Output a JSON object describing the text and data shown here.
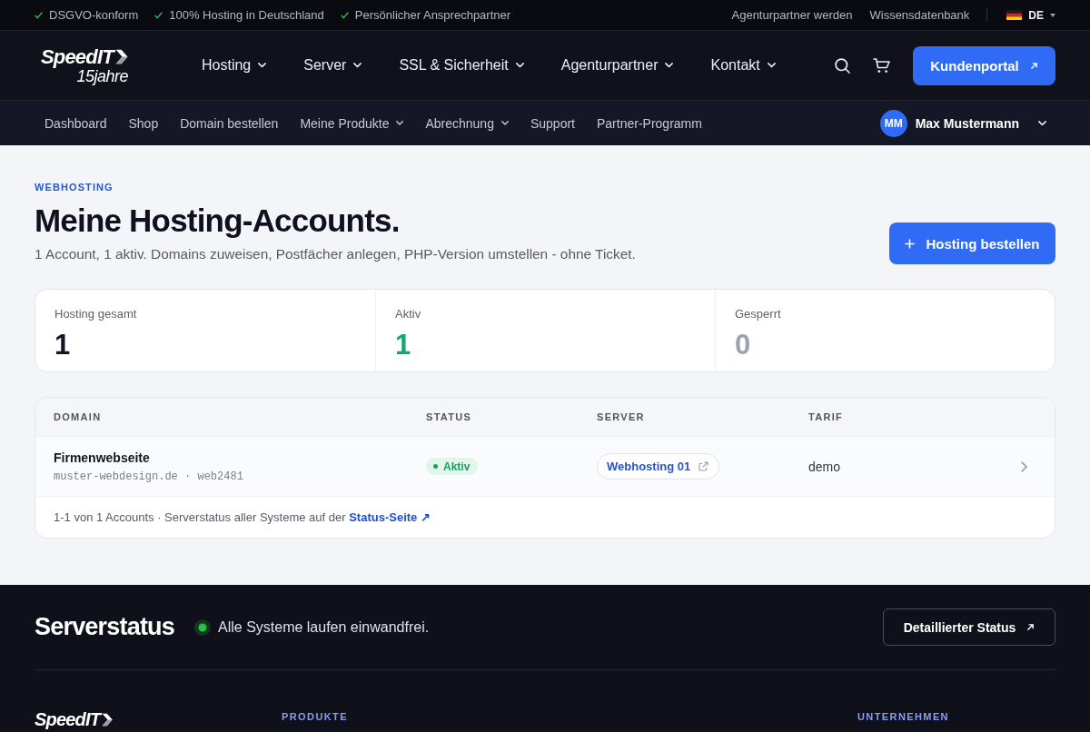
{
  "top_bar": {
    "badges": [
      "DSGVO-konform",
      "100% Hosting in Deutschland",
      "Persönlicher Ansprechpartner"
    ],
    "links": [
      "Agenturpartner werden",
      "Wissensdatenbank"
    ],
    "language": "DE"
  },
  "header": {
    "logo": {
      "wordmark": "SpeedIT",
      "tagline": "15jahre"
    },
    "nav": [
      {
        "label": "Hosting",
        "has_menu": true
      },
      {
        "label": "Server",
        "has_menu": true
      },
      {
        "label": "SSL & Sicherheit",
        "has_menu": true
      },
      {
        "label": "Agenturpartner",
        "has_menu": true
      },
      {
        "label": "Kontakt",
        "has_menu": true
      }
    ],
    "cta": "Kundenportal"
  },
  "subnav": {
    "items": [
      {
        "label": "Dashboard",
        "has_menu": false
      },
      {
        "label": "Shop",
        "has_menu": false
      },
      {
        "label": "Domain bestellen",
        "has_menu": false
      },
      {
        "label": "Meine Produkte",
        "has_menu": true
      },
      {
        "label": "Abrechnung",
        "has_menu": true
      },
      {
        "label": "Support",
        "has_menu": false
      },
      {
        "label": "Partner-Programm",
        "has_menu": false
      }
    ],
    "user": {
      "initials": "MM",
      "name": "Max Mustermann"
    }
  },
  "page": {
    "eyebrow": "WEBHOSTING",
    "title": "Meine Hosting-Accounts.",
    "subtitle": "1 Account, 1 aktiv. Domains zuweisen, Postfächer anlegen, PHP-Version umstellen - ohne Ticket.",
    "action": "Hosting bestellen"
  },
  "stats": [
    {
      "label": "Hosting gesamt",
      "value": "1",
      "color": "#111827"
    },
    {
      "label": "Aktiv",
      "value": "1",
      "color": "#16a570"
    },
    {
      "label": "Gesperrt",
      "value": "0",
      "color": "#9ca3af"
    }
  ],
  "table": {
    "columns": [
      "DOMAIN",
      "STATUS",
      "SERVER",
      "TARIF"
    ],
    "rows": [
      {
        "name": "Firmenwebseite",
        "details": "muster-webdesign.de · web2481",
        "status": {
          "label": "Aktiv",
          "kind": "active"
        },
        "server": "Webhosting 01",
        "tariff": "demo"
      }
    ],
    "footer": {
      "text": "1-1 von 1 Accounts · Serverstatus aller Systeme auf der",
      "link": "Status-Seite ↗"
    }
  },
  "server_status": {
    "title": "Serverstatus",
    "operational": true,
    "message": "Alle Systeme laufen einwandfrei.",
    "button": "Detaillierter Status"
  },
  "footer": {
    "logo": {
      "wordmark": "SpeedIT"
    },
    "headings": [
      "PRODUKTE",
      "UNTERNEHMEN"
    ]
  }
}
